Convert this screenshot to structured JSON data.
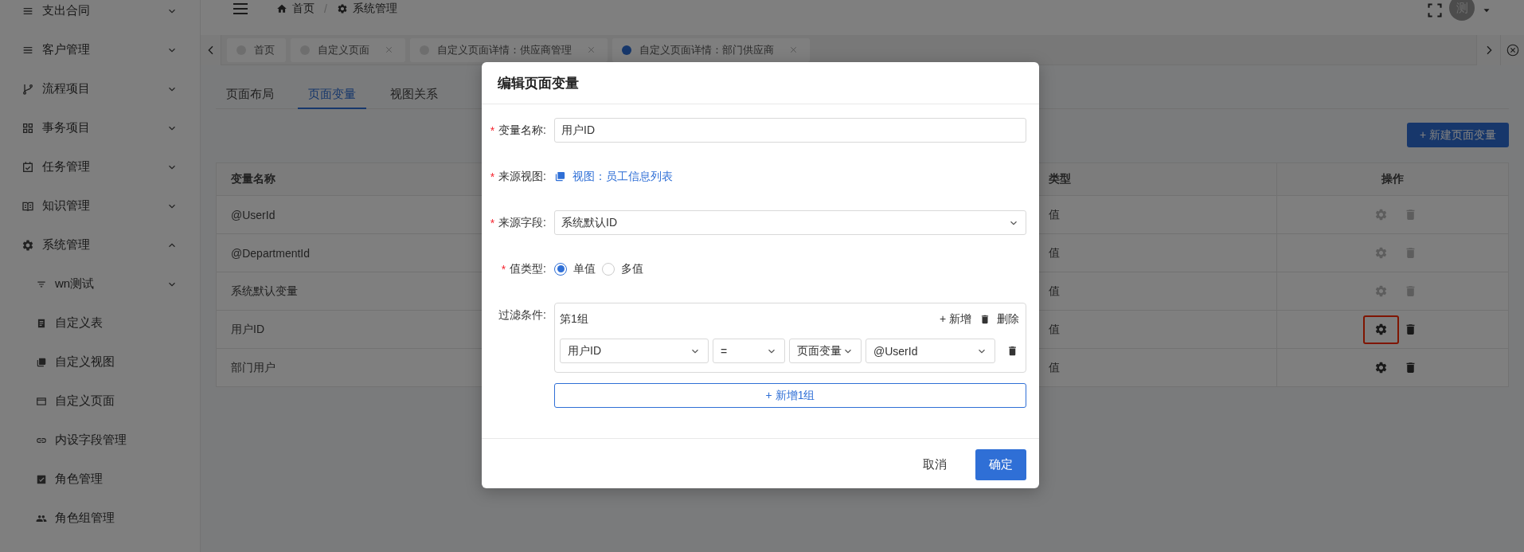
{
  "sidebar": {
    "items": [
      {
        "label": "支出合同",
        "expanded": false
      },
      {
        "label": "客户管理",
        "expanded": false
      },
      {
        "label": "流程项目",
        "expanded": false
      },
      {
        "label": "事务项目",
        "expanded": false
      },
      {
        "label": "任务管理",
        "expanded": false
      },
      {
        "label": "知识管理",
        "expanded": false
      },
      {
        "label": "系统管理",
        "expanded": true,
        "children": [
          {
            "label": "wn测试",
            "expanded": false
          },
          {
            "label": "自定义表"
          },
          {
            "label": "自定义视图"
          },
          {
            "label": "自定义页面"
          },
          {
            "label": "内设字段管理"
          },
          {
            "label": "角色管理"
          },
          {
            "label": "角色组管理"
          }
        ]
      }
    ]
  },
  "header": {
    "breadcrumb": [
      "首页",
      "系统管理"
    ],
    "separator": "/",
    "avatar": "测"
  },
  "tabs": [
    {
      "label": "首页",
      "selected": false,
      "closable": false
    },
    {
      "label": "自定义页面",
      "selected": false,
      "closable": true
    },
    {
      "label": "自定义页面详情：供应商管理",
      "selected": false,
      "closable": true
    },
    {
      "label": "自定义页面详情：部门供应商",
      "selected": true,
      "closable": true
    }
  ],
  "page_tabs": [
    {
      "label": "页面布局",
      "selected": false
    },
    {
      "label": "页面变量",
      "selected": true
    },
    {
      "label": "视图关系",
      "selected": false
    }
  ],
  "new_button": "+ 新建页面变量",
  "table": {
    "columns": [
      "变量名称",
      "类型",
      "操作"
    ],
    "rows": [
      {
        "name": "@UserId",
        "type": "值",
        "disabled": true,
        "highlighted": false
      },
      {
        "name": "@DepartmentId",
        "type": "值",
        "disabled": true,
        "highlighted": false
      },
      {
        "name": "系统默认变量",
        "type": "值",
        "disabled": true,
        "highlighted": false
      },
      {
        "name": "用户ID",
        "type": "值",
        "disabled": false,
        "highlighted": true
      },
      {
        "name": "部门用户",
        "type": "值",
        "disabled": false,
        "highlighted": false
      }
    ]
  },
  "modal": {
    "title": "编辑页面变量",
    "required_mark": "*",
    "fields": [
      {
        "kind": "input",
        "label": "变量名称:",
        "required": true,
        "value": "用户ID"
      },
      {
        "kind": "link",
        "label": "来源视图:",
        "required": true,
        "value": "视图：员工信息列表"
      },
      {
        "kind": "select",
        "label": "来源字段:",
        "required": true,
        "value": "系统默认ID"
      },
      {
        "kind": "radio",
        "label": "值类型:",
        "required": true,
        "options": [
          {
            "label": "单值",
            "selected": true
          },
          {
            "label": "多值",
            "selected": false
          }
        ]
      },
      {
        "kind": "filter",
        "label": "过滤条件:",
        "required": false,
        "groups": [
          {
            "title": "第1组",
            "add": "+ 新增",
            "delete": "删除",
            "conditions": [
              {
                "field": "用户ID",
                "operator": "=",
                "source": "页面变量",
                "value": "@UserId"
              }
            ]
          }
        ],
        "add_group": "+ 新增1组"
      }
    ],
    "buttons": [
      {
        "label": "取消",
        "kind": "default"
      },
      {
        "label": "确定",
        "kind": "primary"
      }
    ]
  }
}
